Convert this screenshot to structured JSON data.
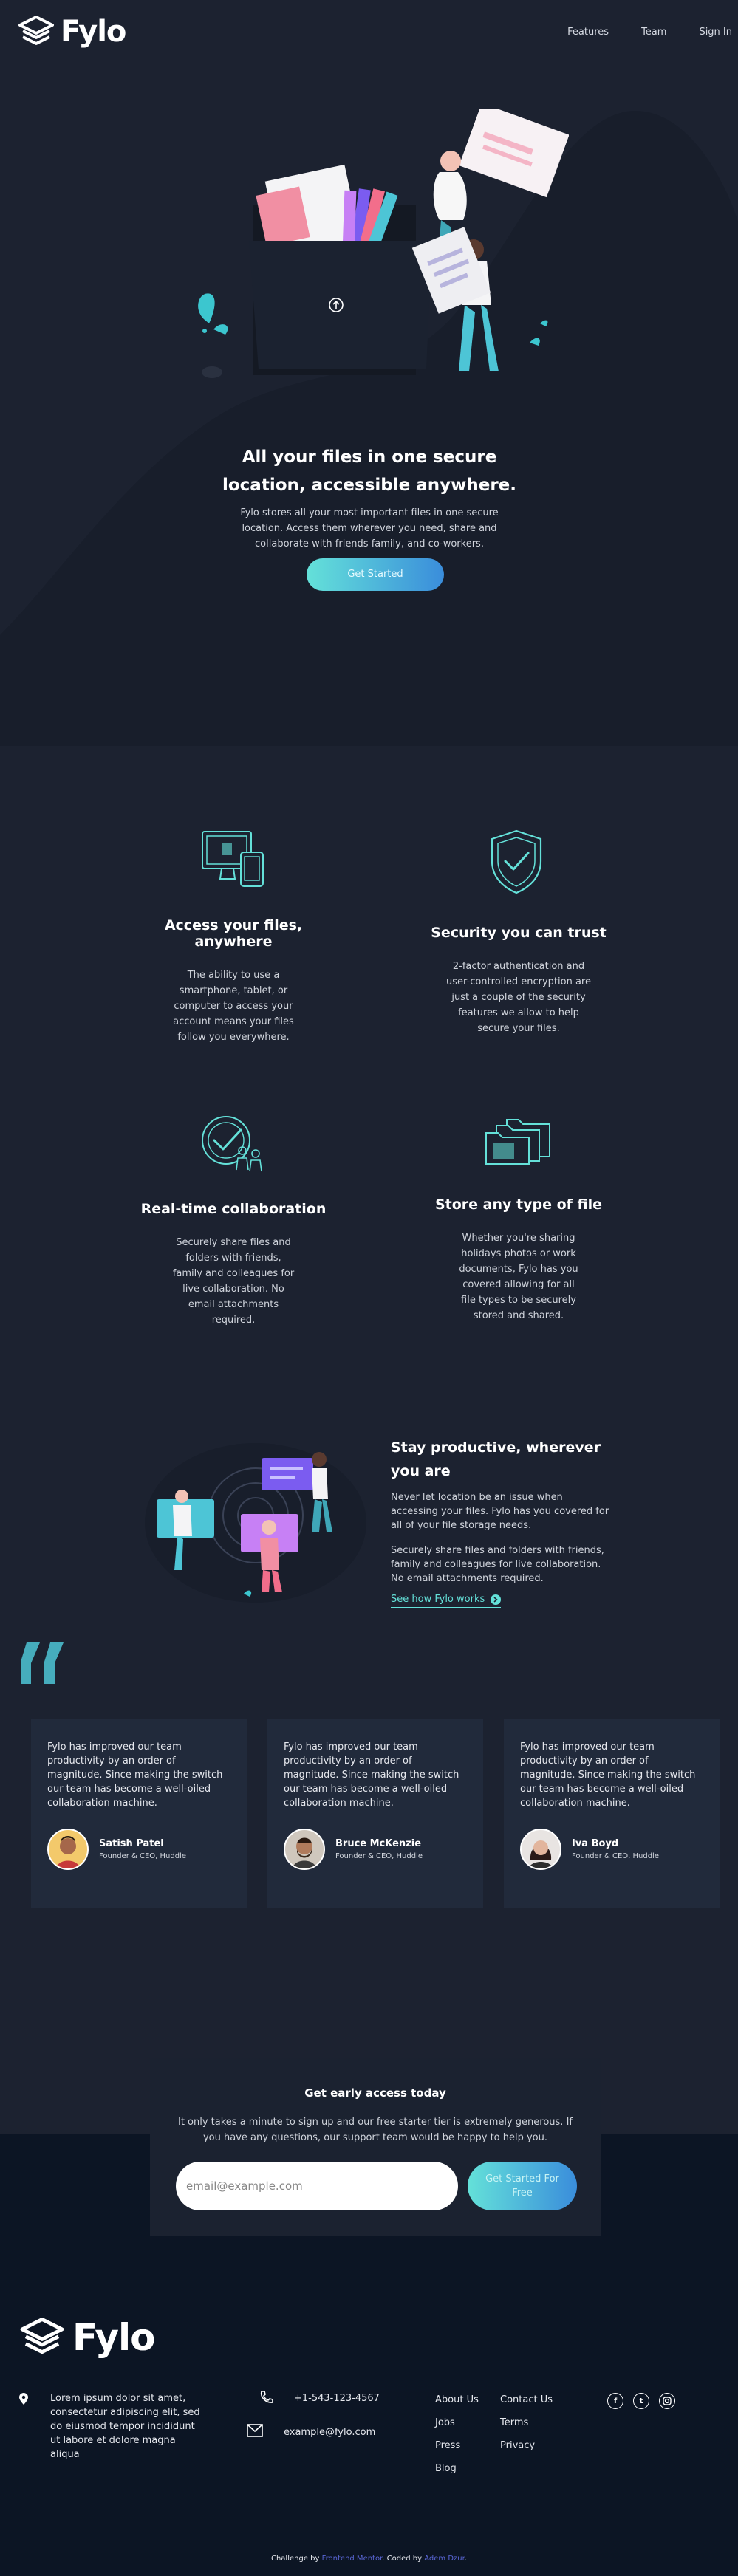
{
  "header": {
    "logo_text": "Fylo",
    "nav": [
      {
        "label": "Features"
      },
      {
        "label": "Team"
      },
      {
        "label": "Sign In"
      }
    ]
  },
  "hero": {
    "title": "All your files in one secure location, accessible anywhere.",
    "text": "Fylo stores all your most important files in one secure location. Access them wherever you need, share and collaborate with friends family, and co-workers.",
    "cta_label": "Get Started"
  },
  "features": [
    {
      "icon": "devices-icon",
      "title": "Access your files, anywhere",
      "text": "The ability to use a smartphone, tablet, or computer to access your account means your files follow you everywhere."
    },
    {
      "icon": "shield-check-icon",
      "title": "Security you can trust",
      "text": "2-factor authentication and user-controlled encryption are just a couple of the security features we allow to help secure your files."
    },
    {
      "icon": "collaboration-icon",
      "title": "Real-time collaboration",
      "text": "Securely share files and folders with friends, family and colleagues for live collaboration. No email attachments required."
    },
    {
      "icon": "folders-icon",
      "title": "Store any type of file",
      "text": "Whether you're sharing holidays photos or work documents, Fylo has you covered allowing for all file types to be securely stored and shared."
    }
  ],
  "productive": {
    "title": "Stay productive, wherever you are",
    "paragraph1": "Never let location be an issue when accessing your files. Fylo has you covered for all of your file storage needs.",
    "paragraph2": "Securely share files and folders with friends, family and colleagues for live collaboration. No email attachments required.",
    "link_label": "See how Fylo works"
  },
  "testimonials": [
    {
      "text": "Fylo has improved our team productivity by an order of magnitude. Since making the switch our team has become a well-oiled collaboration machine.",
      "name": "Satish Patel",
      "role": "Founder & CEO, Huddle"
    },
    {
      "text": "Fylo has improved our team productivity by an order of magnitude. Since making the switch our team has become a well-oiled collaboration machine.",
      "name": "Bruce McKenzie",
      "role": "Founder & CEO, Huddle"
    },
    {
      "text": "Fylo has improved our team productivity by an order of magnitude. Since making the switch our team has become a well-oiled collaboration machine.",
      "name": "Iva Boyd",
      "role": "Founder & CEO, Huddle"
    }
  ],
  "cta": {
    "title": "Get early access today",
    "text": "It only takes a minute to sign up and our free starter tier is extremely generous. If you have any questions, our support team would be happy to help you.",
    "email_placeholder": "email@example.com",
    "button_label": "Get Started For Free"
  },
  "footer": {
    "logo_text": "Fylo",
    "address": "Lorem ipsum dolor sit amet, consectetur adipiscing elit, sed do eiusmod tempor incididunt ut labore et dolore magna aliqua",
    "phone": "+1-543-123-4567",
    "email": "example@fylo.com",
    "links_col1": [
      "About Us",
      "Jobs",
      "Press",
      "Blog"
    ],
    "links_col2": [
      "Contact Us",
      "Terms",
      "Privacy"
    ],
    "social": [
      "facebook-icon",
      "twitter-icon",
      "instagram-icon"
    ]
  },
  "attribution": {
    "prefix": "Challenge by",
    "challenge_link": "Frontend Mentor",
    "middle": ". Coded by",
    "author_link": "Adem Dzur",
    "suffix": "."
  },
  "colors": {
    "background": "#1c2230",
    "footer_bg": "#0c1524",
    "card_bg": "#212a3b",
    "accent_cyan": "#64e1d9",
    "accent_blue": "#3a8ddb"
  }
}
